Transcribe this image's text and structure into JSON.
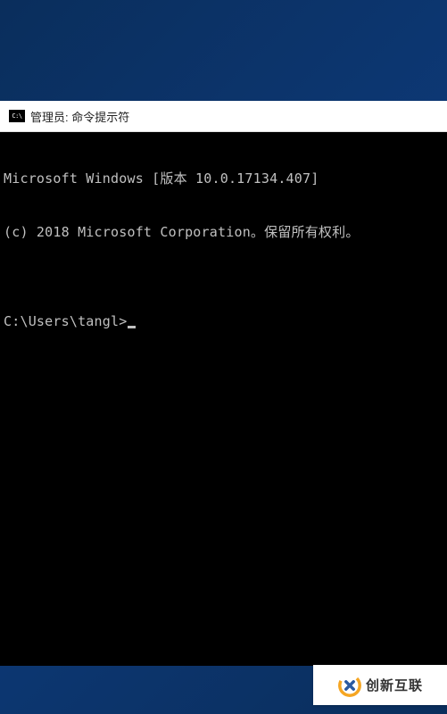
{
  "window": {
    "titlebar": {
      "icon_text": "C:\\",
      "title": "管理员: 命令提示符"
    },
    "terminal": {
      "line1": "Microsoft Windows [版本 10.0.17134.407]",
      "line2": "(c) 2018 Microsoft Corporation。保留所有权利。",
      "blank": "",
      "prompt": "C:\\Users\\tangl>"
    }
  },
  "watermark": {
    "text": "创新互联"
  }
}
